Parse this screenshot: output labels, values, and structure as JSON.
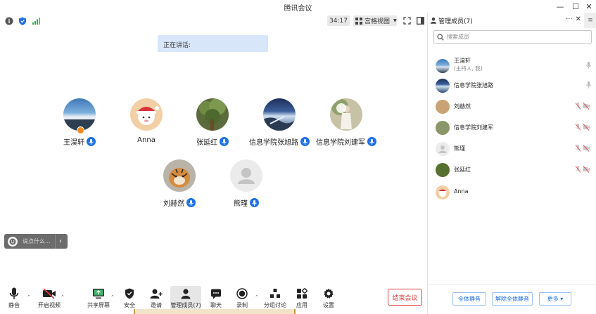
{
  "window": {
    "title": "腾讯会议",
    "controls": {
      "minimize": "—",
      "maximize": "☐",
      "close": "✕"
    }
  },
  "toolbar": {
    "timer": "34:17",
    "view_mode": "宫格视图",
    "signal_color": "#2fae4e",
    "shield_color": "#1f6fe5"
  },
  "stage": {
    "speaking_label": "正在讲话:",
    "participants": [
      {
        "name": "王淏轩",
        "avatar": "lake",
        "host": true
      },
      {
        "name": "Anna",
        "avatar": "santa"
      },
      {
        "name": "张延红",
        "avatar": "tree"
      },
      {
        "name": "信息学院张旭路",
        "avatar": "sea"
      },
      {
        "name": "信息学院刘建军",
        "avatar": "girl"
      },
      {
        "name": "刘赫然",
        "avatar": "tiger"
      },
      {
        "name": "熊瑾",
        "avatar": "default"
      }
    ]
  },
  "chat": {
    "placeholder": "说点什么...",
    "collapse_glyph": "‹"
  },
  "bottom_toolbar": {
    "mute": "静音",
    "video": "开启视频",
    "share": "共享屏幕",
    "security": "安全",
    "invite": "邀请",
    "members": "管理成员(7)",
    "chat": "聊天",
    "record": "录制",
    "breakout": "分组讨论",
    "apps": "应用",
    "settings": "设置",
    "end_meeting": "结束会议",
    "accent": "#e23c3c"
  },
  "panel": {
    "title": "管理成员(7)",
    "more": "···",
    "close": "✕",
    "menu": "≡",
    "search_placeholder": "搜索成员",
    "members": [
      {
        "name": "王淏轩",
        "sub": "(主持人, 我)",
        "avatar": "lake",
        "status": "mic"
      },
      {
        "name": "信息学院张旭路",
        "avatar": "sea",
        "status": "mic"
      },
      {
        "name": "刘赫然",
        "avatar": "tiger",
        "status": "muted"
      },
      {
        "name": "信息学院刘建军",
        "avatar": "girl",
        "status": "muted"
      },
      {
        "name": "熊瑾",
        "avatar": "default",
        "status": "muted"
      },
      {
        "name": "张延红",
        "avatar": "tree",
        "status": "muted"
      },
      {
        "name": "Anna",
        "avatar": "santa",
        "status": "none"
      }
    ],
    "mute_all": "全体静音",
    "unmute_all": "解除全体静音",
    "more_btn": "更多 ▾",
    "accent": "#1f6fe5"
  }
}
